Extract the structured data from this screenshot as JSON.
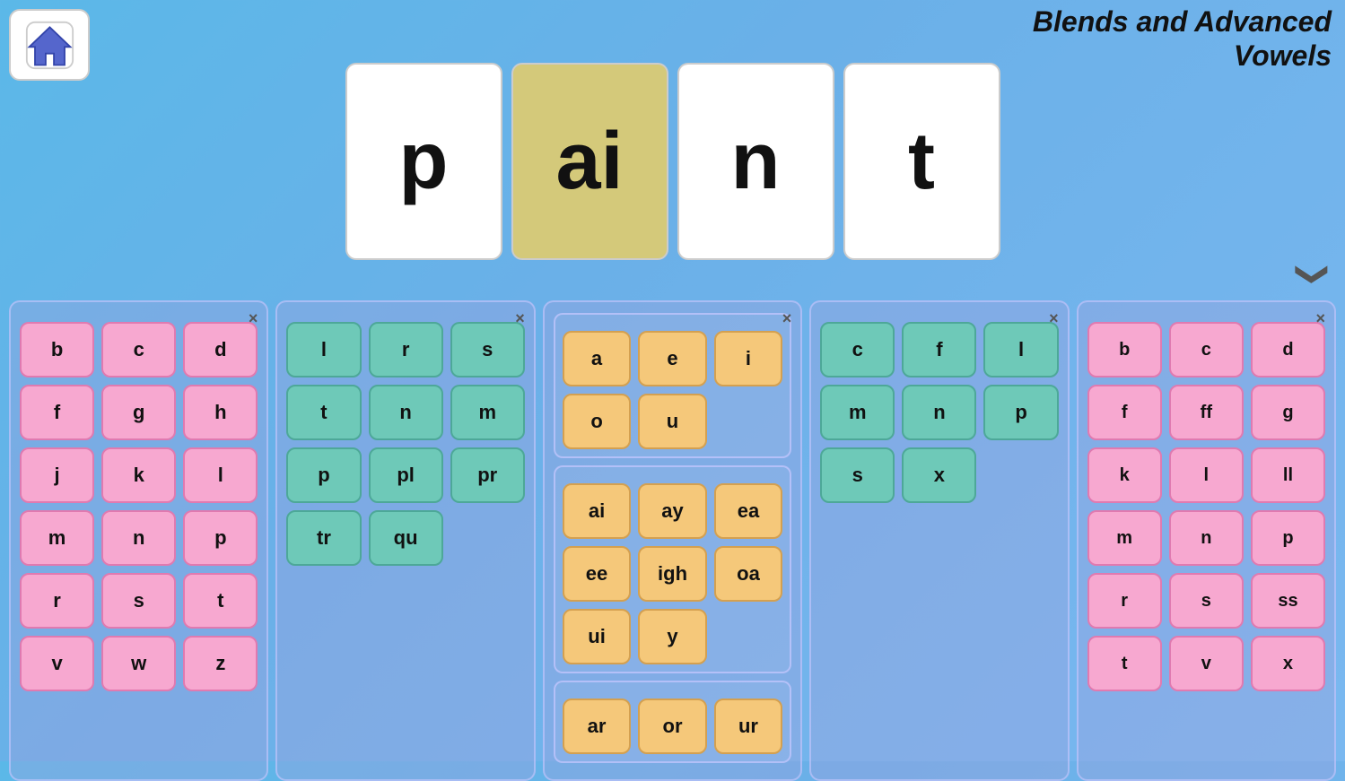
{
  "app": {
    "title_line1": "Blends and Advanced",
    "title_line2": "Vowels"
  },
  "home": {
    "label": "Home"
  },
  "word": {
    "tiles": [
      "p",
      "ai",
      "n",
      "t"
    ],
    "highlighted_index": 1
  },
  "chevron": {
    "symbol": "❯",
    "direction": "down"
  },
  "panels": [
    {
      "id": "panel1",
      "close": "×",
      "color": "pink",
      "keys": [
        "b",
        "c",
        "d",
        "f",
        "g",
        "h",
        "j",
        "k",
        "l",
        "m",
        "n",
        "p",
        "r",
        "s",
        "t",
        "v",
        "w",
        "z"
      ],
      "cols": 3
    },
    {
      "id": "panel2",
      "close": "×",
      "color": "teal",
      "keys": [
        "l",
        "r",
        "s",
        "t",
        "n",
        "m",
        "p",
        "pl",
        "pr",
        "tr",
        "qu"
      ],
      "cols": 3
    },
    {
      "id": "panel3",
      "close": "×",
      "color": "orange",
      "subpanels": [
        [
          "a",
          "e",
          "i",
          "o",
          "u"
        ],
        [
          "ai",
          "ay",
          "ea",
          "ee",
          "igh",
          "oa",
          "ui",
          "y"
        ],
        [
          "ar",
          "or",
          "ur"
        ]
      ]
    },
    {
      "id": "panel4",
      "close": "×",
      "color": "teal",
      "keys": [
        "c",
        "f",
        "l",
        "m",
        "n",
        "p",
        "s",
        "x"
      ],
      "cols": 3
    },
    {
      "id": "panel5",
      "close": "×",
      "color": "pink",
      "keys": [
        "b",
        "c",
        "d",
        "f",
        "ff",
        "g",
        "k",
        "l",
        "ll",
        "m",
        "n",
        "p",
        "r",
        "s",
        "ss",
        "t",
        "v",
        "x"
      ],
      "cols": 3
    }
  ]
}
